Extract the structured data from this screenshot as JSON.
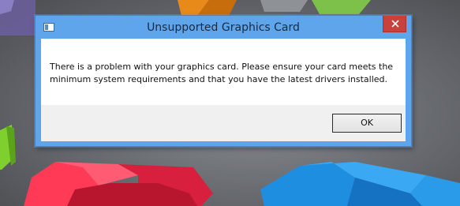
{
  "dialog": {
    "title": "Unsupported Graphics Card",
    "message": "There is a problem with your graphics card. Please ensure your card meets the minimum system requirements and that you have the latest drivers installed.",
    "ok_label": "OK"
  },
  "icons": {
    "app": "app-window-icon",
    "close": "close-icon"
  },
  "colors": {
    "titlebar": "#5fa5ec",
    "close_button": "#c9413b",
    "content_background": "#ffffff",
    "button_bar": "#f0f0f0"
  }
}
